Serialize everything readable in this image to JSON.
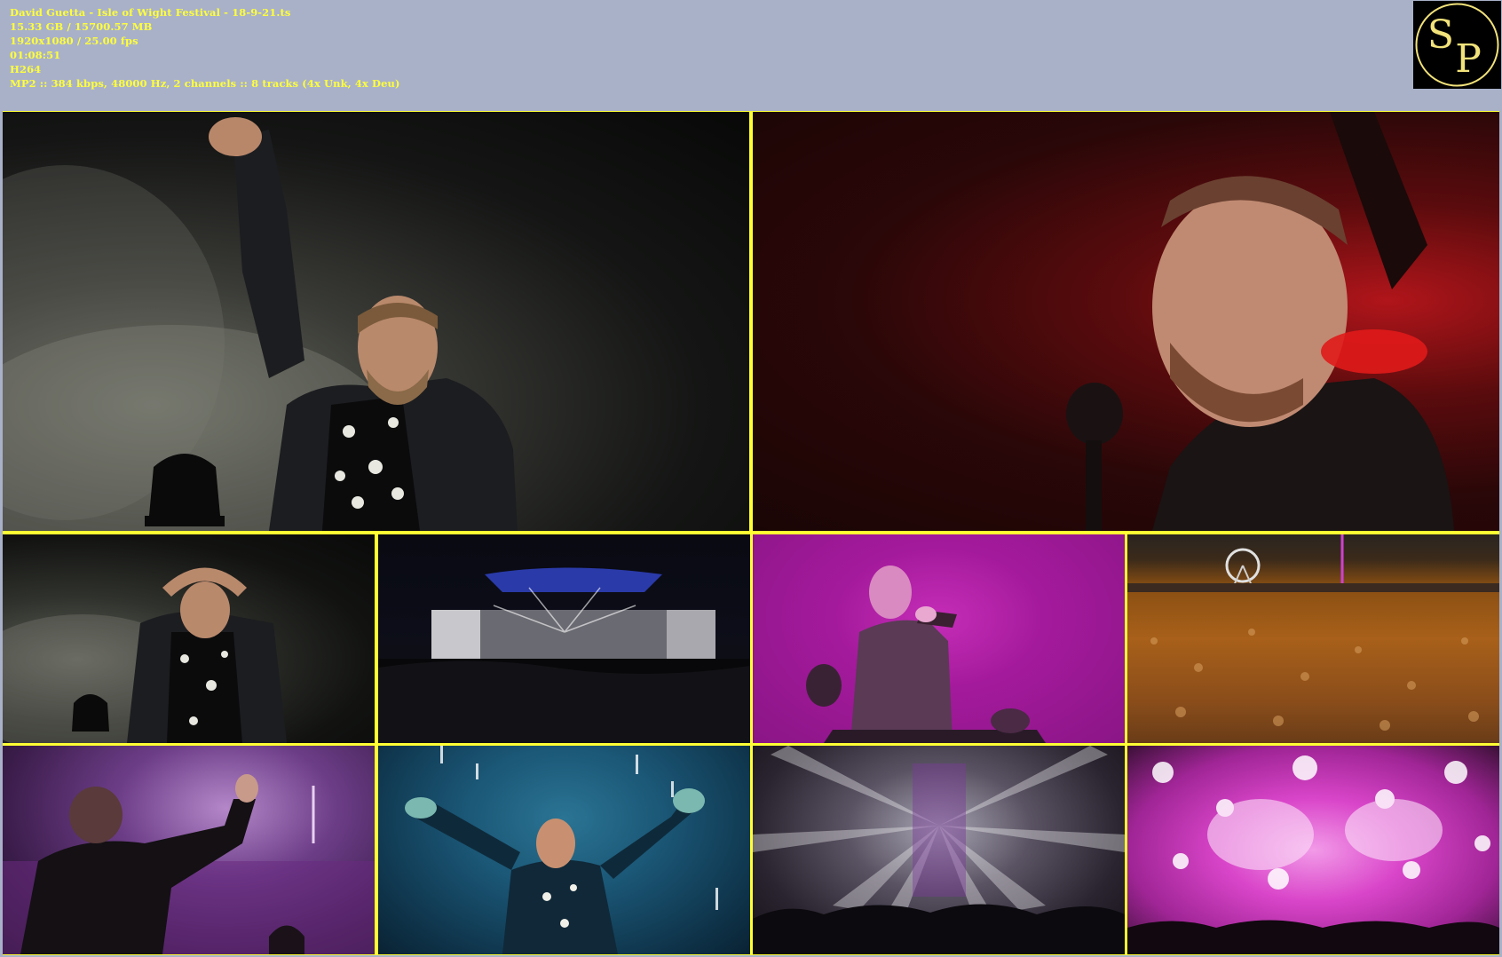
{
  "info": {
    "filename": "David Guetta - Isle of Wight Festival - 18-9-21.ts",
    "size": "15.33 GB / 15700.57 MB",
    "video": "1920x1080 / 25.00 fps",
    "duration": "01:08:51",
    "codec": "H264",
    "audio": "MP2 :: 384 kbps, 48000 Hz, 2 channels :: 8 tracks (4x Unk, 4x Deu)"
  },
  "logo": {
    "letter1": "S",
    "letter2": "P"
  },
  "colors": {
    "background": "#a9b1c9",
    "info_text": "#ffff3a",
    "grid_border": "#ffff33",
    "logo_gold": "#f2e27a"
  },
  "frames": [
    {
      "scene": "performer-arm-raised-smoke"
    },
    {
      "scene": "performer-profile-red-light"
    },
    {
      "scene": "performer-heart-hands"
    },
    {
      "scene": "stage-wide-dark"
    },
    {
      "scene": "performer-microphone-magenta"
    },
    {
      "scene": "crowd-ferris-wheel"
    },
    {
      "scene": "performer-thumbs-up-purple"
    },
    {
      "scene": "performer-arms-spread-blue"
    },
    {
      "scene": "stage-light-beams"
    },
    {
      "scene": "confetti-pink-stage"
    }
  ]
}
